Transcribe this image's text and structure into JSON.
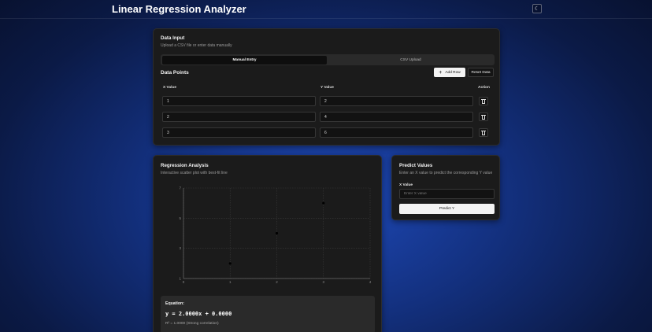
{
  "app": {
    "title": "Linear Regression Analyzer",
    "theme_icon": "moon-icon"
  },
  "data_input": {
    "title": "Data Input",
    "subtitle": "Upload a CSV file or enter data manually",
    "tabs": [
      {
        "label": "Manual Entry",
        "active": true
      },
      {
        "label": "CSV Upload",
        "active": false
      }
    ],
    "points_title": "Data Points",
    "add_row_label": "Add Row",
    "reset_label": "Reset Data",
    "columns": {
      "x": "X Value",
      "y": "Y Value",
      "action": "Action"
    },
    "rows": [
      {
        "x": "1",
        "y": "2"
      },
      {
        "x": "2",
        "y": "4"
      },
      {
        "x": "3",
        "y": "6"
      }
    ]
  },
  "regression": {
    "title": "Regression Analysis",
    "subtitle": "Interactive scatter plot with best-fit line",
    "equation_label": "Equation:",
    "equation": "y = 2.0000x + 0.0000",
    "r2_text": "R² = 1.0000 (Strong correlation)"
  },
  "predict": {
    "title": "Predict Values",
    "subtitle": "Enter an X value to predict the corresponding Y value",
    "x_label": "X Value",
    "x_placeholder": "Enter X value",
    "button_label": "Predict Y"
  },
  "chart_data": {
    "type": "scatter",
    "x": [
      1,
      2,
      3
    ],
    "y": [
      2,
      4,
      6
    ],
    "xlim": [
      0,
      4
    ],
    "ylim": [
      1,
      7
    ],
    "x_ticks": [
      "0",
      "1",
      "2",
      "3",
      "4"
    ],
    "y_ticks": [
      "1",
      "3",
      "5",
      "7"
    ],
    "grid": true,
    "fit_line": {
      "slope": 2,
      "intercept": 0
    }
  }
}
